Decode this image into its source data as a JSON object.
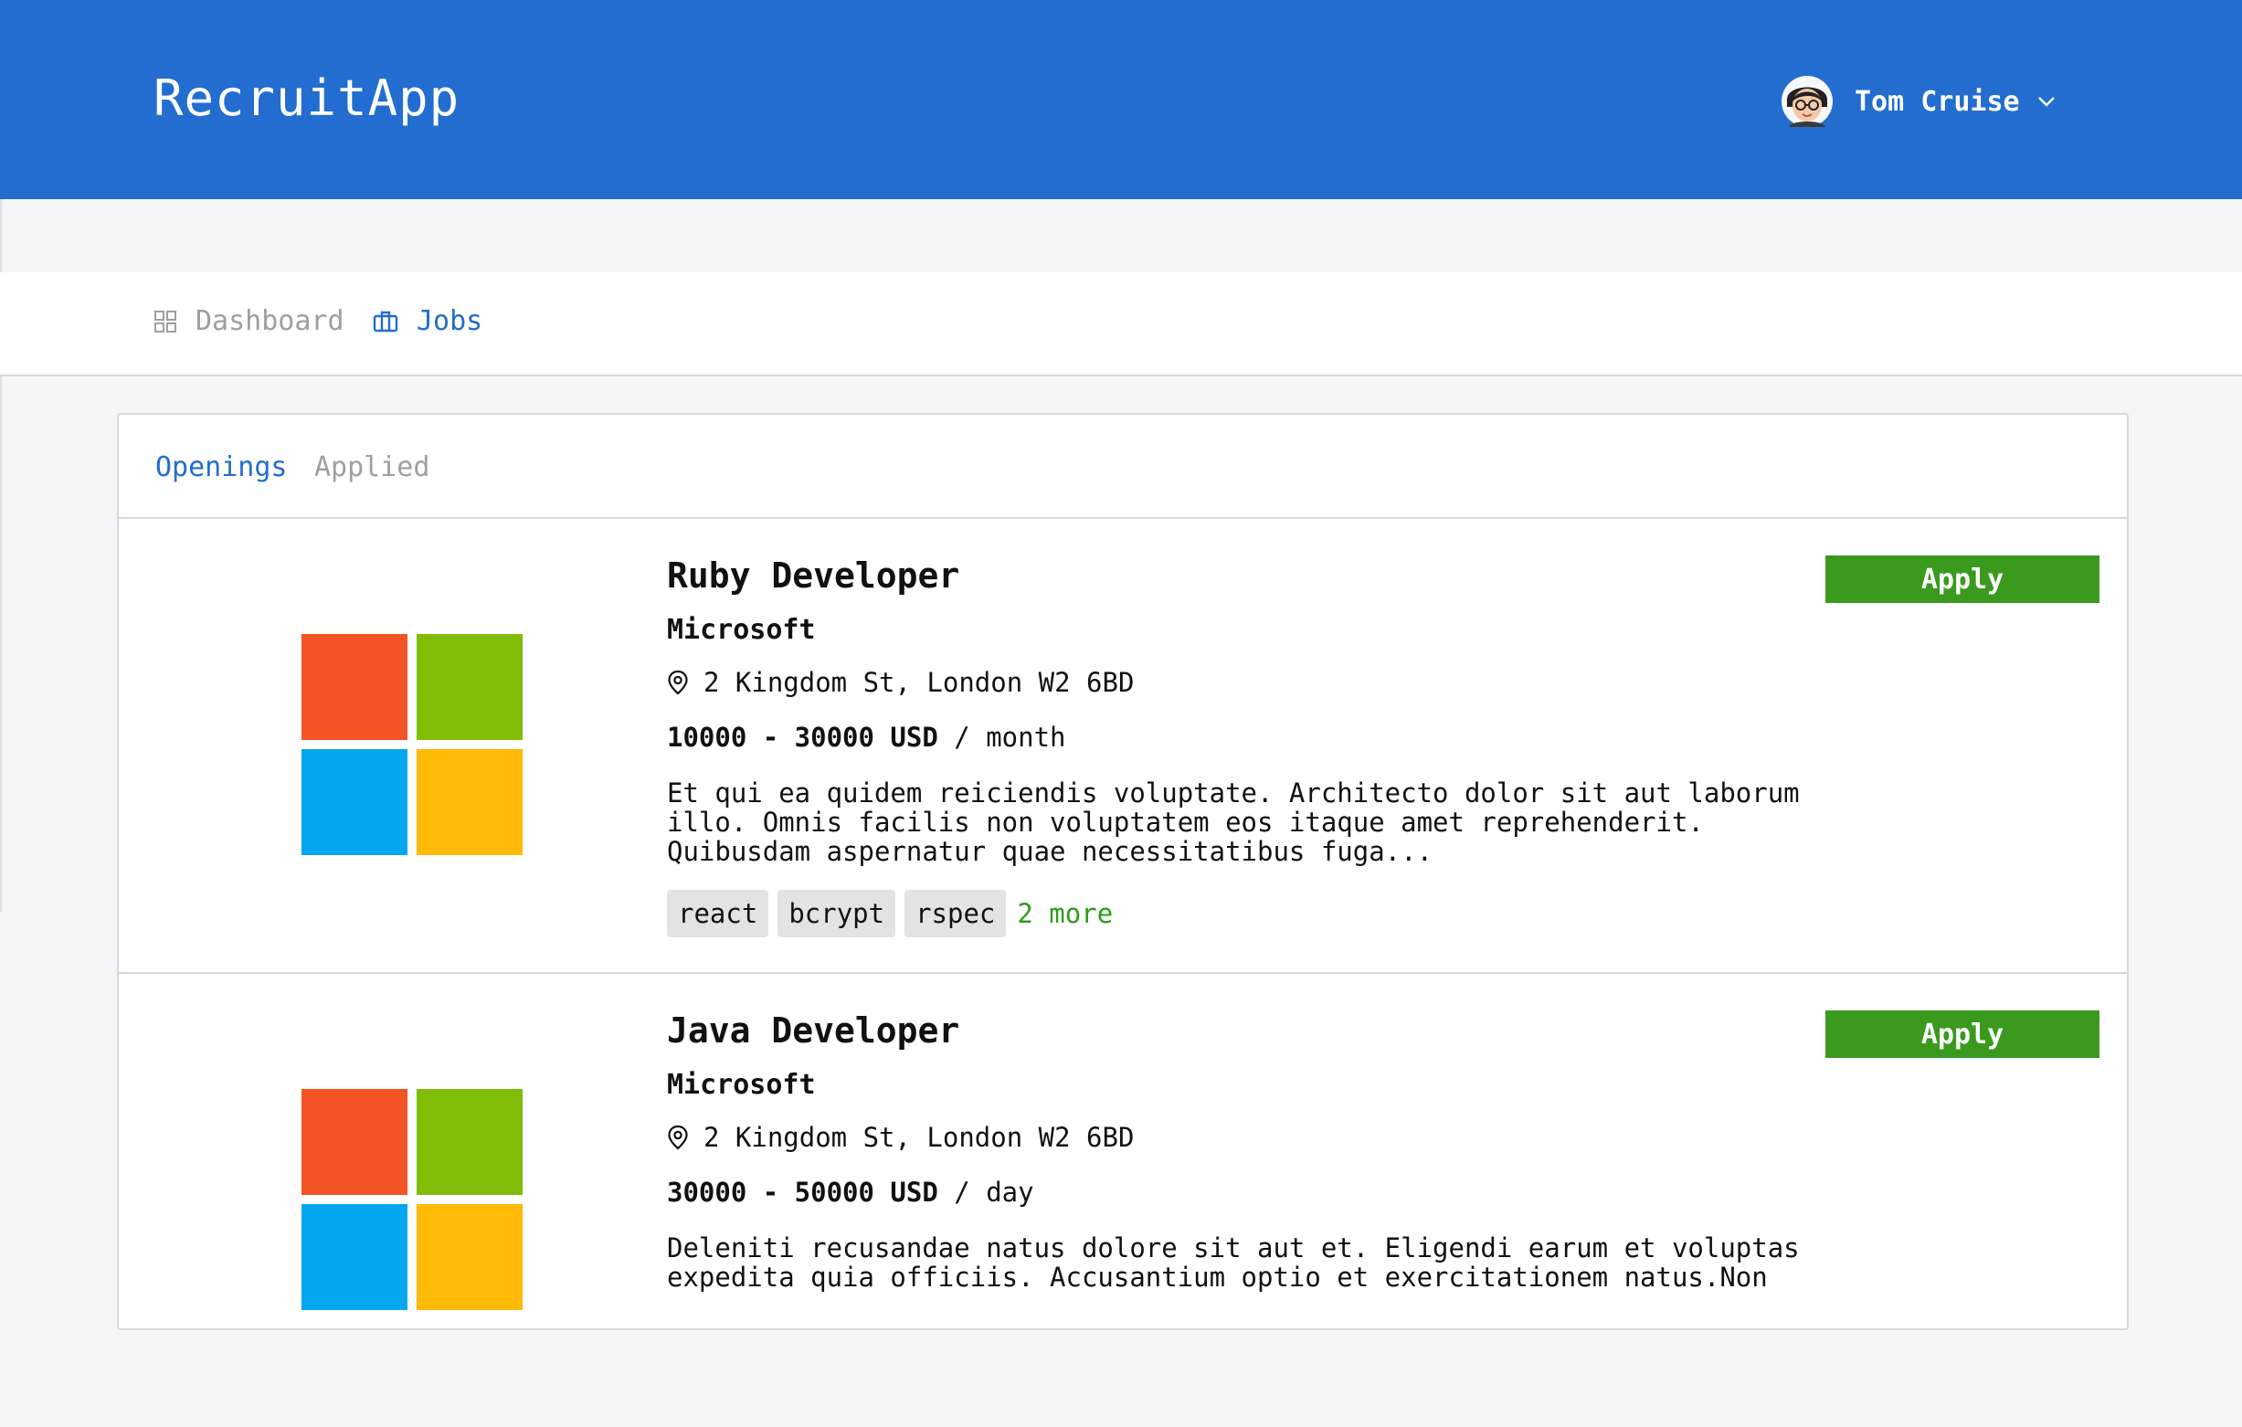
{
  "app": {
    "brand": "RecruitApp"
  },
  "user": {
    "name": "Tom Cruise",
    "avatar_icon": "avatar-icon",
    "menu_icon": "chevron-down-icon"
  },
  "nav": [
    {
      "label": "Dashboard",
      "icon": "grid-icon"
    },
    {
      "label": "Jobs",
      "icon": "briefcase-icon"
    }
  ],
  "tabs": [
    {
      "label": "Openings",
      "active": true
    },
    {
      "label": "Applied",
      "active": false
    }
  ],
  "jobs": [
    {
      "title": "Ruby Developer",
      "company": "Microsoft",
      "location": "2 Kingdom St, London W2 6BD",
      "salary_range": "10000 - 30000 USD",
      "salary_period": " / month",
      "description": "Et qui ea quidem reiciendis voluptate. Architecto dolor sit aut laborum illo. Omnis facilis non voluptatem eos itaque amet reprehenderit. Quibusdam aspernatur quae necessitatibus fuga...",
      "tags": [
        "react",
        "bcrypt",
        "rspec"
      ],
      "more": "2 more",
      "apply_label": "Apply"
    },
    {
      "title": "Java Developer",
      "company": "Microsoft",
      "location": "2 Kingdom St, London W2 6BD",
      "salary_range": "30000 - 50000 USD",
      "salary_period": " / day",
      "description": "Deleniti recusandae natus dolore sit aut et. Eligendi earum et voluptas expedita quia officiis. Accusantium optio et exercitationem natus.Non",
      "apply_label": "Apply"
    }
  ],
  "colors": {
    "header": "#226dcf",
    "apply": "#3a9a1d",
    "more": "#2e9c1c",
    "logo_red": "#f35325",
    "logo_green": "#81bc06",
    "logo_blue": "#05a6f0",
    "logo_yellow": "#ffba08"
  }
}
